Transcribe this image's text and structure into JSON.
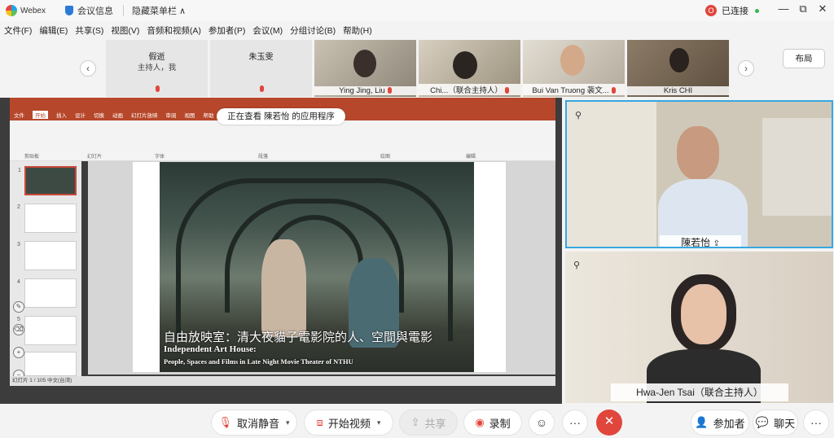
{
  "titlebar": {
    "app_name": "Webex",
    "meeting_info": "会议信息",
    "hide_menu": "隐藏菜单栏 ∧",
    "status_initial": "O",
    "status": "已连接",
    "window_controls": [
      "—",
      "⧉",
      "✕"
    ]
  },
  "menu": [
    "文件(F)",
    "编辑(E)",
    "共享(S)",
    "视图(V)",
    "音频和视频(A)",
    "参加者(P)",
    "会议(M)",
    "分组讨论(B)",
    "帮助(H)"
  ],
  "strip": {
    "prev_icon": "chevron-left-icon",
    "next_icon": "chevron-right-icon",
    "tiles": [
      {
        "name": "假逝",
        "sub": "主持人，我",
        "type": "avatar"
      },
      {
        "name": "朱玉雯",
        "sub": "",
        "type": "avatar"
      },
      {
        "name": "Ying Jing, Liu",
        "type": "video"
      },
      {
        "name": "Chi...（联合主持人）",
        "type": "video"
      },
      {
        "name": "Bui Van Truong 裴文...",
        "type": "video"
      },
      {
        "name": "Kris CHI",
        "type": "video"
      }
    ],
    "layout_label": "布局"
  },
  "shared": {
    "viewing_label": "正在查看 陳若怡 的应用程序",
    "ribbon_tabs": [
      "文件",
      "开始",
      "插入",
      "设计",
      "切换",
      "动画",
      "幻灯片放映",
      "审阅",
      "视图",
      "帮助"
    ],
    "ribbon_groups": [
      "剪贴板",
      "幻灯片",
      "字体",
      "段落",
      "绘图",
      "编辑"
    ],
    "slide_numbers": [
      "1",
      "2",
      "3",
      "4",
      "5",
      "6"
    ],
    "slide_caption_zh": "自由放映室：清大夜貓子電影院的人、空間與電影",
    "slide_caption_en1": "Independent Art House:",
    "slide_caption_en2": "People, Spaces and Films in Late Night Movie Theater of NTHU",
    "statusbar": "幻灯片 1 / 105    中文(台湾)"
  },
  "videos": [
    {
      "name": "陳若怡",
      "active": true
    },
    {
      "name": "Hwa-Jen Tsai（联合主持人）",
      "active": false
    }
  ],
  "controls": {
    "mute": "取消静音",
    "video": "开始视频",
    "share": "共享",
    "record": "录制",
    "more": "···",
    "end_icon": "close-icon",
    "participants": "参加者",
    "chat": "聊天"
  },
  "colors": {
    "accent_red": "#e0463c",
    "active_border": "#36a7e0",
    "ppt_red": "#b7472a"
  }
}
